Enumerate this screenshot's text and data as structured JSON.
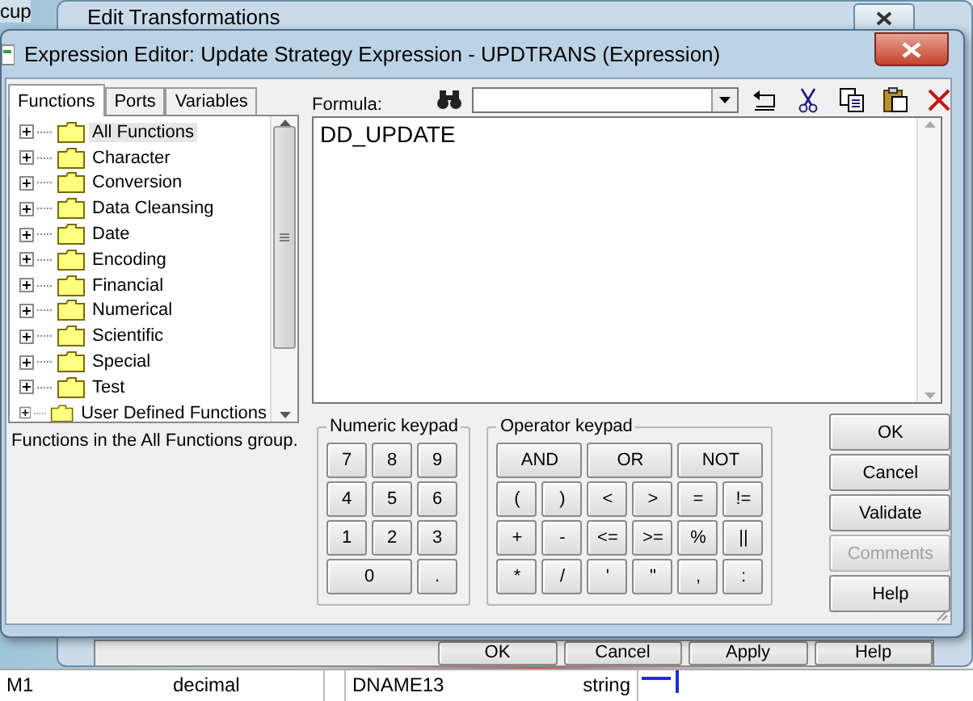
{
  "background_app": {
    "corner_text": "cup",
    "left_rows": [
      {
        "name": "M1",
        "type": "decimal"
      }
    ],
    "right_rows": [
      {
        "name": "DNAME13",
        "type": "string"
      }
    ]
  },
  "back_window": {
    "title": "Edit Transformations",
    "buttons": [
      "OK",
      "Cancel",
      "Apply",
      "Help"
    ]
  },
  "dialog": {
    "title": "Expression Editor: Update Strategy Expression - UPDTRANS (Expression)",
    "tabs": [
      {
        "label": "Functions",
        "selected": true
      },
      {
        "label": "Ports",
        "selected": false
      },
      {
        "label": "Variables",
        "selected": false
      }
    ],
    "tree": [
      {
        "label": "All Functions",
        "selected": true
      },
      {
        "label": "Character",
        "selected": false
      },
      {
        "label": "Conversion",
        "selected": false
      },
      {
        "label": "Data Cleansing",
        "selected": false
      },
      {
        "label": "Date",
        "selected": false
      },
      {
        "label": "Encoding",
        "selected": false
      },
      {
        "label": "Financial",
        "selected": false
      },
      {
        "label": "Numerical",
        "selected": false
      },
      {
        "label": "Scientific",
        "selected": false
      },
      {
        "label": "Special",
        "selected": false
      },
      {
        "label": "Test",
        "selected": false
      },
      {
        "label": "User Defined Functions",
        "selected": false
      }
    ],
    "status": "Functions in the All Functions group.",
    "formula": {
      "label": "Formula:",
      "value": "DD_UPDATE"
    },
    "numeric_keypad": {
      "title": "Numeric keypad",
      "keys": [
        {
          "label": "7",
          "kind": "normal"
        },
        {
          "label": "8",
          "kind": "normal"
        },
        {
          "label": "9",
          "kind": "normal"
        },
        {
          "label": "4",
          "kind": "normal"
        },
        {
          "label": "5",
          "kind": "normal"
        },
        {
          "label": "6",
          "kind": "normal"
        },
        {
          "label": "1",
          "kind": "normal"
        },
        {
          "label": "2",
          "kind": "normal"
        },
        {
          "label": "3",
          "kind": "normal"
        },
        {
          "label": "0",
          "kind": "wide"
        },
        {
          "label": ".",
          "kind": "normal"
        }
      ]
    },
    "operator_keypad": {
      "title": "Operator keypad",
      "rows": [
        [
          "AND",
          "OR",
          "NOT"
        ],
        [
          "(",
          ")",
          "<",
          ">",
          "=",
          "!="
        ],
        [
          "+",
          "-",
          "<=",
          ">=",
          "%",
          "||"
        ],
        [
          "*",
          "/",
          "'",
          "\"",
          ",",
          ":"
        ]
      ]
    },
    "buttons": [
      {
        "label": "OK",
        "disabled": false
      },
      {
        "label": "Cancel",
        "disabled": false
      },
      {
        "label": "Validate",
        "disabled": false
      },
      {
        "label": "Comments",
        "disabled": true
      },
      {
        "label": "Help",
        "disabled": false
      }
    ]
  }
}
